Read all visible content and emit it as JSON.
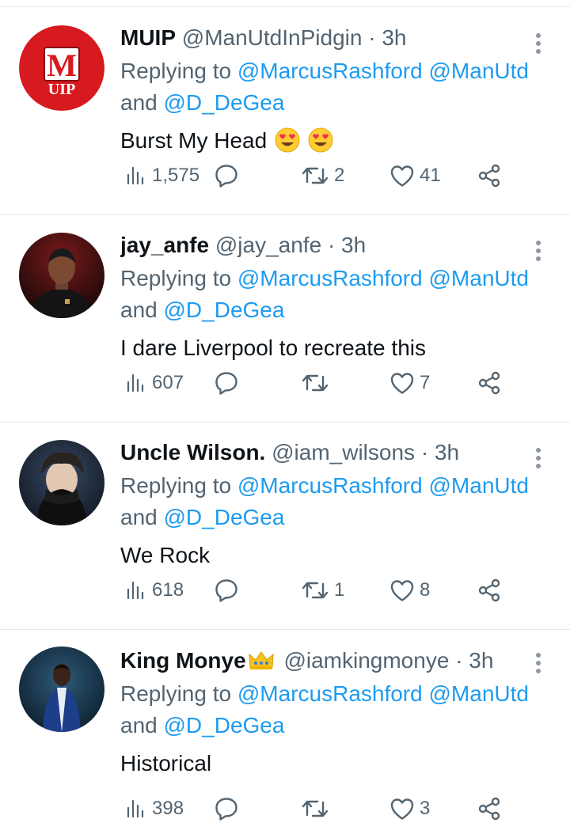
{
  "tweets": [
    {
      "name": "MUIP",
      "handle": "@ManUtdInPidgin",
      "dot": "·",
      "time": "3h",
      "replying_prefix": "Replying to",
      "mention_1": "@MarcusRashford",
      "mention_2": "@ManUtd",
      "and_word": "and",
      "mention_3": "@D_DeGea",
      "text": "Burst My Head",
      "emoji": "heart-eyes-emoji x2",
      "views": "1,575",
      "replies": "",
      "retweets": "2",
      "likes": "41",
      "avatar": "MUIP logo",
      "avatar_logo_letter": "M",
      "avatar_logo_text": "UIP"
    },
    {
      "name": "jay_anfe",
      "handle": "@jay_anfe",
      "dot": "·",
      "time": "3h",
      "replying_prefix": "Replying to",
      "mention_1": "@MarcusRashford",
      "mention_2": "@ManUtd",
      "and_word": "and",
      "mention_3": "@D_DeGea",
      "text": "I dare Liverpool to recreate this",
      "views": "607",
      "replies": "",
      "retweets": "",
      "likes": "7",
      "avatar": "profile photo"
    },
    {
      "name": "Uncle Wilson.",
      "handle": "@iam_wilsons",
      "dot": "·",
      "time": "3h",
      "replying_prefix": "Replying to",
      "mention_1": "@MarcusRashford",
      "mention_2": "@ManUtd",
      "and_word": "and",
      "mention_3": "@D_DeGea",
      "text": "We Rock",
      "views": "618",
      "replies": "",
      "retweets": "1",
      "likes": "8",
      "avatar": "profile photo"
    },
    {
      "name": "King Monye",
      "name_badge": "crown-emoji",
      "handle": "@iamkingmonye",
      "dot": "·",
      "time": "3h",
      "replying_prefix": "Replying to",
      "mention_1": "@MarcusRashford",
      "mention_2": "@ManUtd",
      "and_word": "and",
      "mention_3": "@D_DeGea",
      "text": "Historical",
      "views": "398",
      "replies": "",
      "retweets": "",
      "likes": "3",
      "avatar": "profile photo"
    }
  ],
  "icons": {
    "views": "views-icon",
    "reply": "reply-icon",
    "retweet": "retweet-icon",
    "like": "like-icon",
    "share": "share-icon",
    "more": "more-icon"
  },
  "colors": {
    "link": "#1d9bf0",
    "secondary_text": "#536471",
    "primary_text": "#0f1419",
    "divider": "#e6e9eb",
    "muip_red": "#d71920"
  }
}
